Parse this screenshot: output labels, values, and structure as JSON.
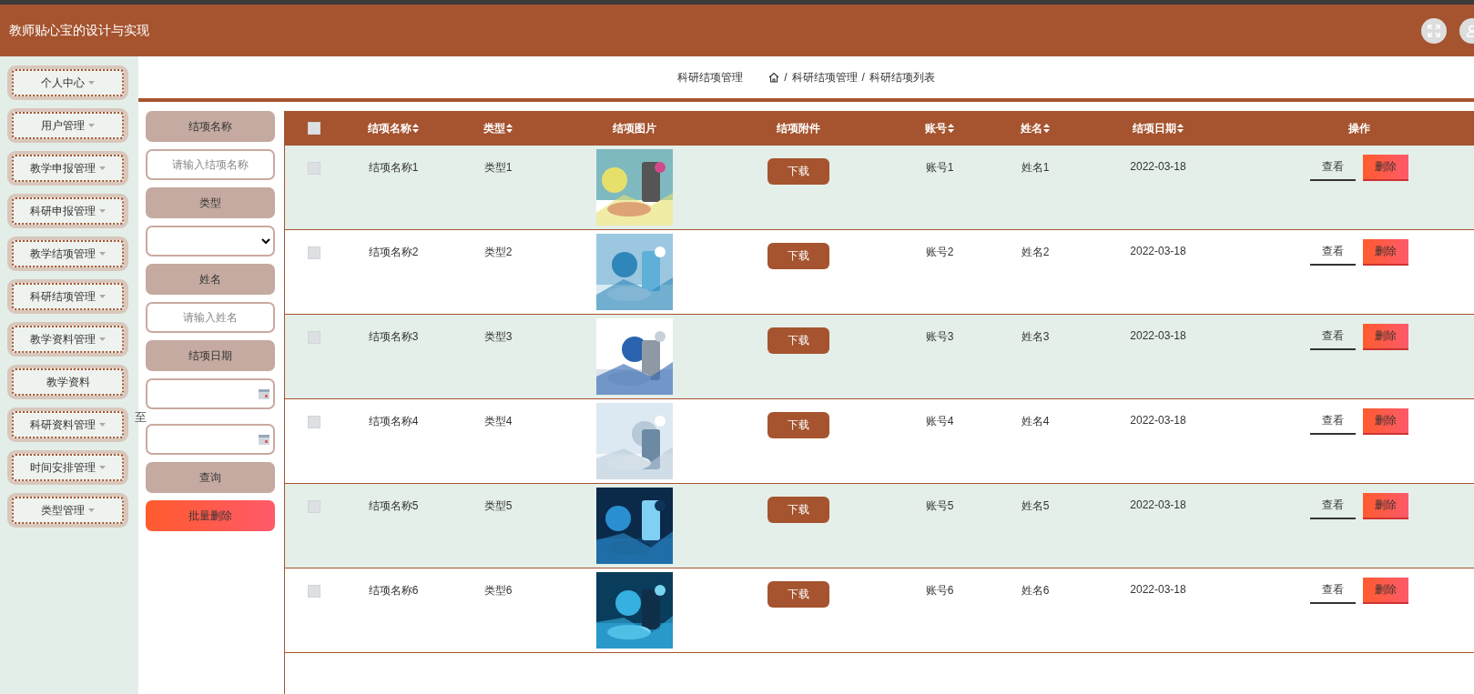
{
  "header": {
    "title": "教师贴心宝的设计与实现"
  },
  "sidebar": {
    "items": [
      {
        "label": "个人中心",
        "kind": "menu"
      },
      {
        "label": "用户管理",
        "kind": "menu"
      },
      {
        "label": "教学申报管理",
        "kind": "menu"
      },
      {
        "label": "科研申报管理",
        "kind": "menu"
      },
      {
        "label": "教学结项管理",
        "kind": "menu"
      },
      {
        "label": "科研结项管理",
        "kind": "menu"
      },
      {
        "label": "教学资料管理",
        "kind": "menu"
      },
      {
        "label": "教学资料",
        "kind": "link"
      },
      {
        "label": "科研资料管理",
        "kind": "menu"
      },
      {
        "label": "时间安排管理",
        "kind": "menu"
      },
      {
        "label": "类型管理",
        "kind": "menu"
      }
    ]
  },
  "breadcrumb": {
    "title": "科研结项管理",
    "path": [
      "科研结项管理",
      "科研结项列表"
    ],
    "separator": "/"
  },
  "filters": {
    "name_label": "结项名称",
    "name_placeholder": "请输入结项名称",
    "type_label": "类型",
    "person_label": "姓名",
    "person_placeholder": "请输入姓名",
    "date_label": "结项日期",
    "range_word": "至",
    "search_button": "查询",
    "batch_delete_button": "批量删除"
  },
  "table": {
    "select_all": {
      "checked": false
    },
    "columns": [
      {
        "label": "结项名称",
        "sortable": true
      },
      {
        "label": "类型",
        "sortable": true
      },
      {
        "label": "结项图片",
        "sortable": false
      },
      {
        "label": "结项附件",
        "sortable": false
      },
      {
        "label": "账号",
        "sortable": true
      },
      {
        "label": "姓名",
        "sortable": true
      },
      {
        "label": "结项日期",
        "sortable": true
      },
      {
        "label": "操作",
        "sortable": false
      }
    ],
    "rows": [
      {
        "checked": false,
        "name": "结项名称1",
        "type": "类型1",
        "download": "下载",
        "account": "账号1",
        "person": "姓名1",
        "date": "2022-03-18",
        "view": "查看",
        "delete": "删除"
      },
      {
        "checked": false,
        "name": "结项名称2",
        "type": "类型2",
        "download": "下载",
        "account": "账号2",
        "person": "姓名2",
        "date": "2022-03-18",
        "view": "查看",
        "delete": "删除"
      },
      {
        "checked": false,
        "name": "结项名称3",
        "type": "类型3",
        "download": "下载",
        "account": "账号3",
        "person": "姓名3",
        "date": "2022-03-18",
        "view": "查看",
        "delete": "删除"
      },
      {
        "checked": false,
        "name": "结项名称4",
        "type": "类型4",
        "download": "下载",
        "account": "账号4",
        "person": "姓名4",
        "date": "2022-03-18",
        "view": "查看",
        "delete": "删除"
      },
      {
        "checked": false,
        "name": "结项名称5",
        "type": "类型5",
        "download": "下载",
        "account": "账号5",
        "person": "姓名5",
        "date": "2022-03-18",
        "view": "查看",
        "delete": "删除"
      },
      {
        "checked": false,
        "name": "结项名称6",
        "type": "类型6",
        "download": "下载",
        "account": "账号6",
        "person": "姓名6",
        "date": "2022-03-18",
        "view": "查看",
        "delete": "删除"
      }
    ]
  }
}
